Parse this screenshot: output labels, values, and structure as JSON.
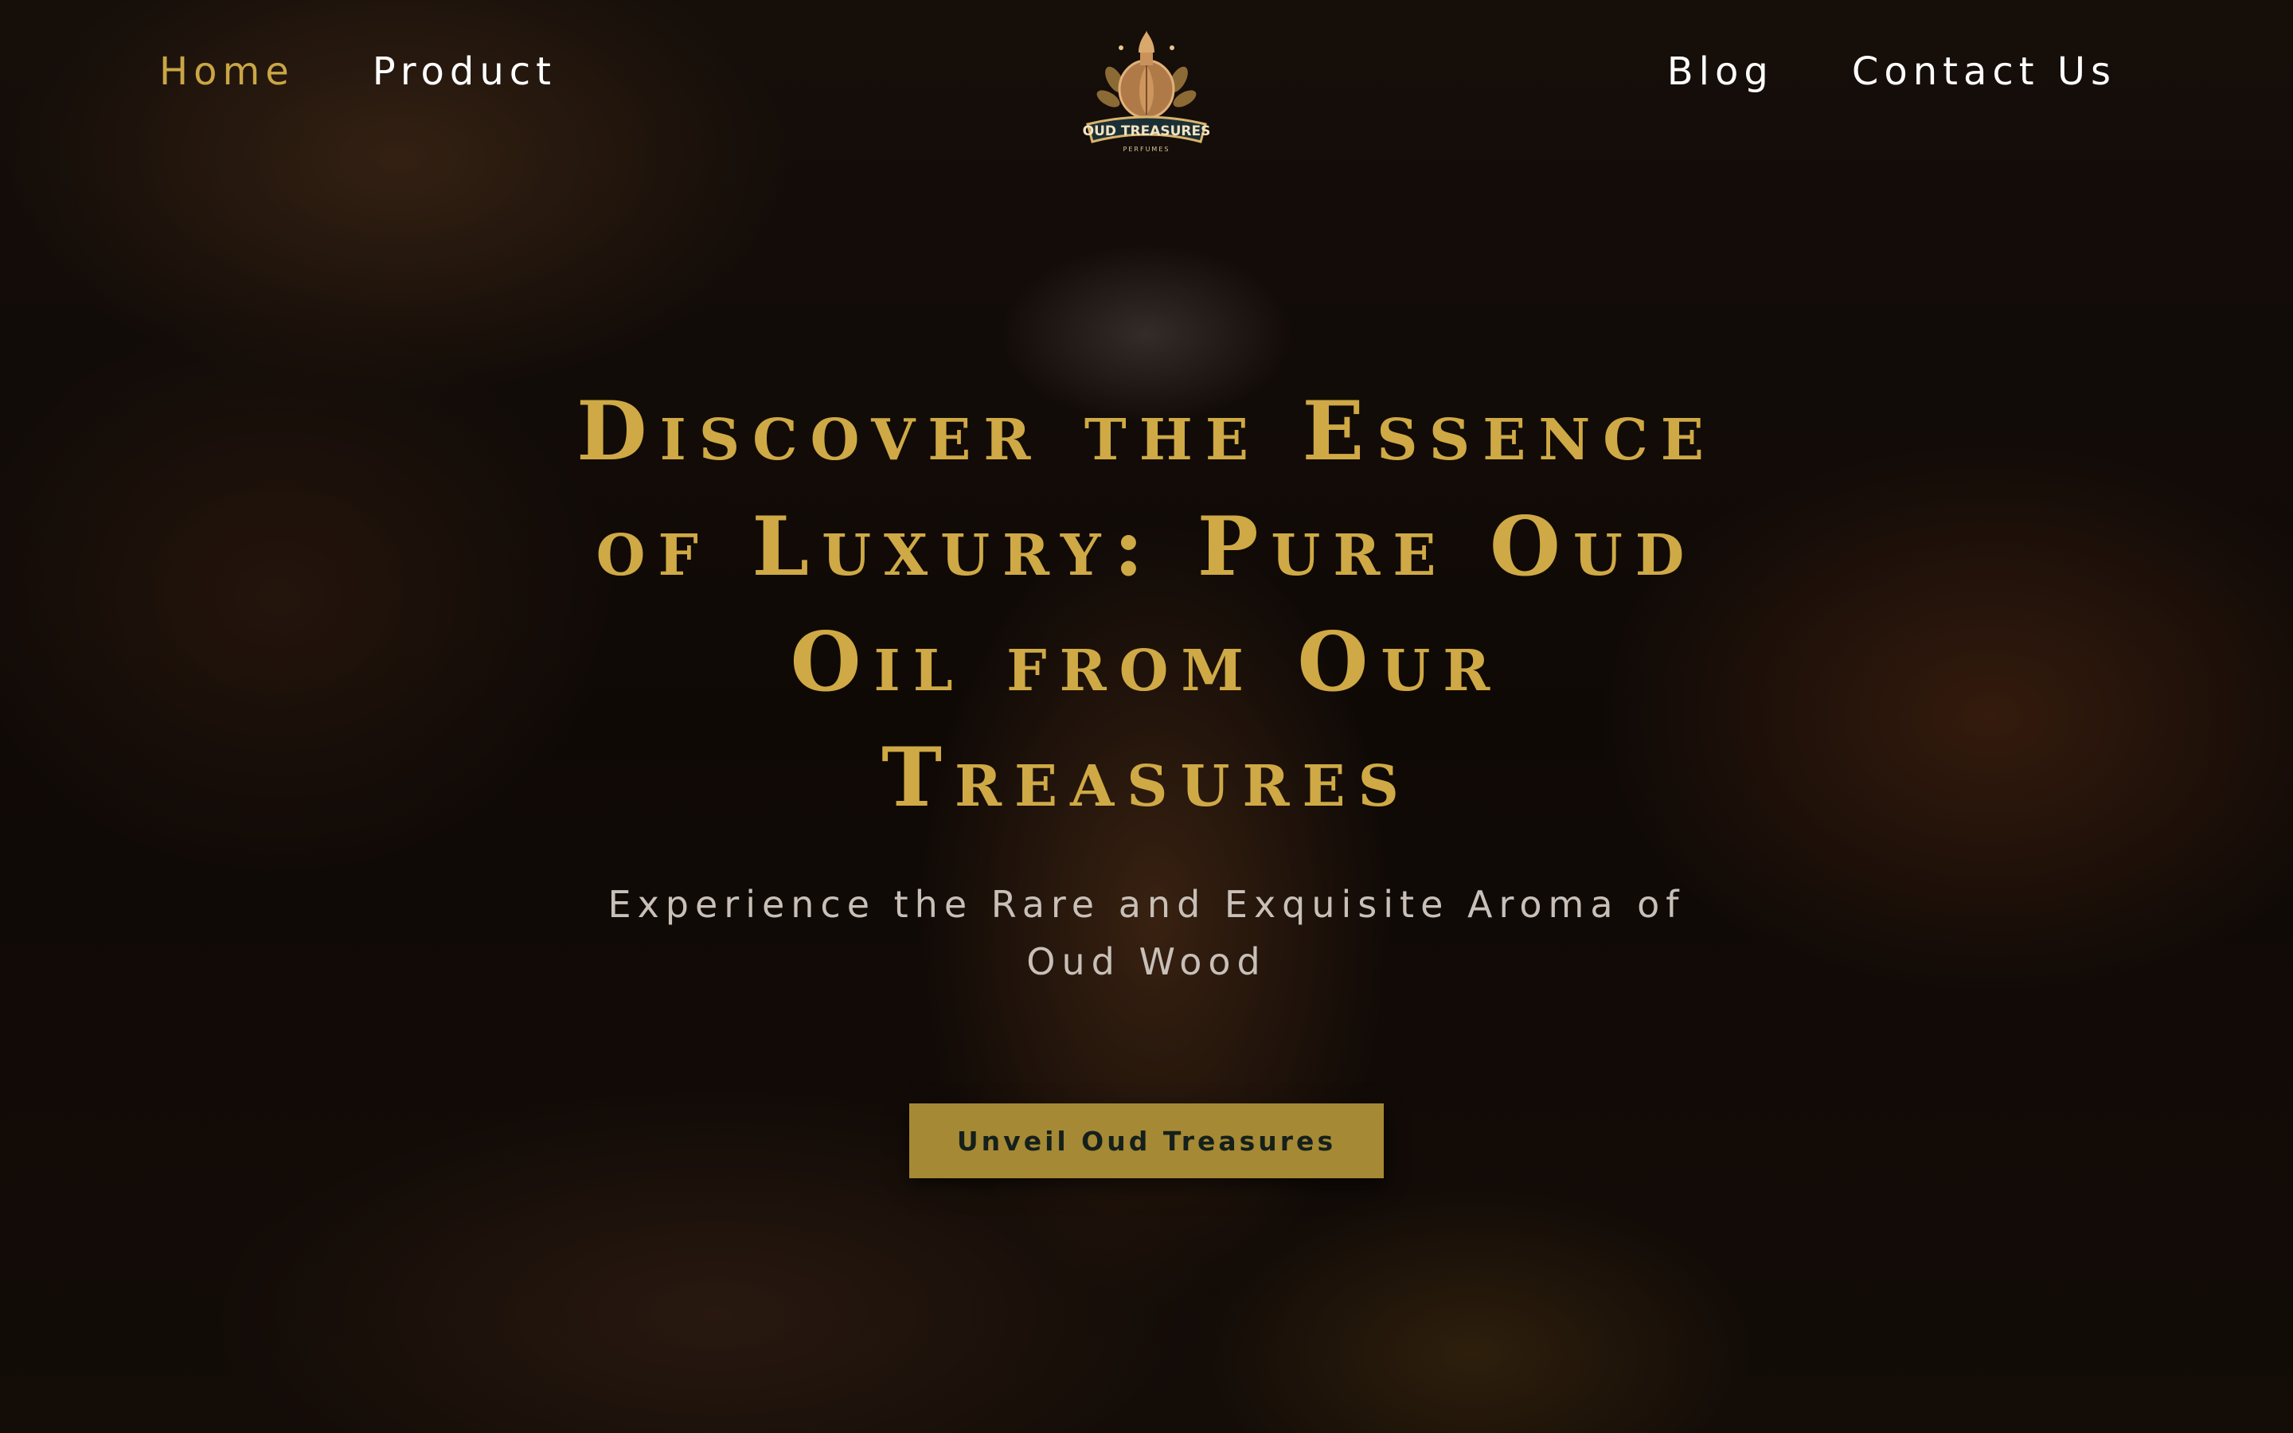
{
  "nav": {
    "left": [
      {
        "label": "Home",
        "active": true
      },
      {
        "label": "Product",
        "active": false
      }
    ],
    "right": [
      {
        "label": "Blog",
        "active": false
      },
      {
        "label": "Contact Us",
        "active": false
      }
    ]
  },
  "logo": {
    "brand": "OUD TREASURES",
    "tagline": "PERFUMES",
    "icon": "perfume-bottle-emblem"
  },
  "hero": {
    "headline": "Discover the Essence\nof Luxury: Pure Oud\nOil from Our\nTreasures",
    "subheadline": "Experience the Rare and Exquisite Aroma of\nOud Wood",
    "cta_label": "Unveil Oud Treasures"
  },
  "colors": {
    "accent_gold": "#cfa945",
    "button_gold": "#a68934",
    "nav_text": "#ffffff",
    "button_text": "#14201b"
  }
}
